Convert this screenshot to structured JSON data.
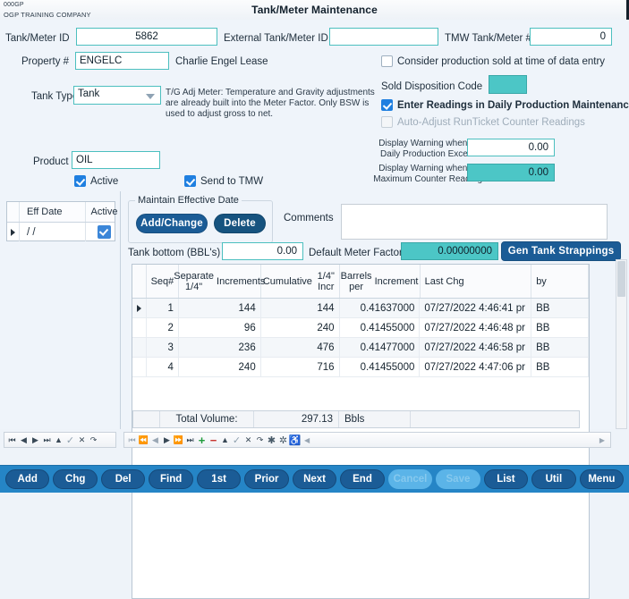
{
  "window": {
    "company_code": "000GP",
    "company_name": "OGP TRAINING COMPANY",
    "title": "Tank/Meter Maintenance"
  },
  "form": {
    "tank_meter_id_label": "Tank/Meter ID",
    "tank_meter_id_value": "5862",
    "external_id_label": "External Tank/Meter ID",
    "external_id_value": "",
    "tmw_number_label": "TMW Tank/Meter #",
    "tmw_number_value": "0",
    "property_label": "Property #",
    "property_value": "ENGELC",
    "property_desc": "Charlie Engel Lease",
    "tank_type_label": "Tank Type",
    "tank_type_value": "Tank",
    "tank_type_helper_line1": "T/G Adj Meter: Temperature and Gravity adjustments",
    "tank_type_helper_line2": "are already built into the Meter Factor. Only BSW is",
    "tank_type_helper_line3": "used to adjust gross to net.",
    "product_label": "Product",
    "product_value": "OIL",
    "active_label": "Active",
    "active_checked": true,
    "send_to_tmw_label": "Send to TMW",
    "send_to_tmw_checked": true,
    "consider_production_label": "Consider production sold at time of data entry",
    "consider_production_checked": false,
    "sold_disposition_label": "Sold Disposition Code",
    "sold_disposition_value": "",
    "enter_readings_label": "Enter Readings in Daily Production Maintenance",
    "enter_readings_checked": true,
    "auto_adjust_label": "Auto-Adjust RunTicket Counter Readings",
    "auto_adjust_checked": false,
    "auto_adjust_disabled": true,
    "warn_daily_label_line1": "Display Warning when the",
    "warn_daily_label_line2": "Daily Production Exceeds",
    "warn_daily_value": "0.00",
    "warn_counter_label_line1": "Display Warning when the",
    "warn_counter_label_line2": "Maximum Counter Reading",
    "warn_counter_value": "0.00"
  },
  "eff_date_grid": {
    "columns": [
      "Eff Date",
      "Active"
    ],
    "rows": [
      {
        "eff_date": "/  /",
        "active": true,
        "selected": true
      }
    ]
  },
  "effective_date_box": {
    "legend": "Maintain Effective Date",
    "add_change_label": "Add/Change",
    "delete_label": "Delete"
  },
  "comments": {
    "label": "Comments",
    "value": ""
  },
  "tank_bottom": {
    "label": "Tank bottom (BBL's)",
    "value": "0.00"
  },
  "meter_factor": {
    "label": "Default Meter Factor",
    "value": "0.00000000"
  },
  "gen_strappings_label": "Gen Tank Strappings",
  "strappings_grid": {
    "columns": [
      "Seq#",
      "Separate 1/4\" Increments",
      "Cumulative 1/4\" Incr",
      "Barrels per Increment",
      "Last Chg",
      "by"
    ],
    "column_lines": [
      [
        "Seq#",
        ""
      ],
      [
        "Separate 1/4\"",
        "Increments"
      ],
      [
        "Cumulative",
        "1/4\" Incr"
      ],
      [
        "Barrels per",
        "Increment"
      ],
      [
        "Last Chg",
        ""
      ],
      [
        "by",
        ""
      ]
    ],
    "rows": [
      {
        "seq": "1",
        "separate": "144",
        "cumulative": "144",
        "barrels": "0.41637000",
        "last_chg": "07/27/2022  4:46:41 pr",
        "by": "BB",
        "selected": true
      },
      {
        "seq": "2",
        "separate": "96",
        "cumulative": "240",
        "barrels": "0.41455000",
        "last_chg": "07/27/2022  4:46:48 pr",
        "by": "BB",
        "selected": false
      },
      {
        "seq": "3",
        "separate": "236",
        "cumulative": "476",
        "barrels": "0.41477000",
        "last_chg": "07/27/2022  4:46:58 pr",
        "by": "BB",
        "selected": false
      },
      {
        "seq": "4",
        "separate": "240",
        "cumulative": "716",
        "barrels": "0.41455000",
        "last_chg": "07/27/2022  4:47:06 pr",
        "by": "BB",
        "selected": false
      }
    ]
  },
  "total_volume": {
    "label": "Total Volume:",
    "value": "297.13",
    "units": "Bbls"
  },
  "bottom_buttons": [
    {
      "label": "Add",
      "accel": "A",
      "disabled": false
    },
    {
      "label": "Chg",
      "accel": "C",
      "disabled": false
    },
    {
      "label": "Del",
      "accel": "D",
      "disabled": false
    },
    {
      "label": "Find",
      "accel": "F",
      "disabled": false
    },
    {
      "label": "1st",
      "accel": "1",
      "disabled": false
    },
    {
      "label": "Prior",
      "accel": "P",
      "disabled": false
    },
    {
      "label": "Next",
      "accel": "N",
      "disabled": false
    },
    {
      "label": "End",
      "accel": "E",
      "disabled": false
    },
    {
      "label": "Cancel",
      "accel": "",
      "disabled": true
    },
    {
      "label": "Save",
      "accel": "",
      "disabled": true
    },
    {
      "label": "List",
      "accel": "L",
      "disabled": false
    },
    {
      "label": "Util",
      "accel": "U",
      "disabled": false
    },
    {
      "label": "Menu",
      "accel": "M",
      "disabled": false
    }
  ],
  "colors": {
    "field_border_teal": "#4cbfbf",
    "field_fill_teal": "#4cc6c6",
    "button_navy": "#1b5c96",
    "button_bar_blue": "#2585c6",
    "panel_bg": "#eff4fa",
    "checkbox_blue": "#1f7fe0"
  }
}
